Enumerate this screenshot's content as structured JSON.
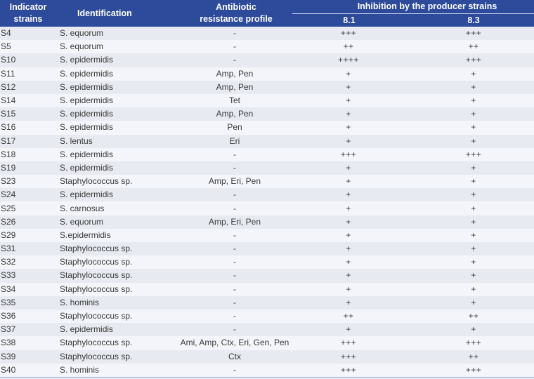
{
  "table": {
    "headers": {
      "indicator_strains": "Indicator strains",
      "identification": "Identification",
      "antibiotic_resistance_profile": "Antibiotic resistance profile",
      "inhibition_group": "Inhibition by the producer strains",
      "producer_1": "8.1",
      "producer_2": "8.3"
    },
    "rows": [
      {
        "strain": "S4",
        "identification": "S. equorum",
        "resistance": "-",
        "inh_8_1": "+++",
        "inh_8_3": "+++"
      },
      {
        "strain": "S5",
        "identification": "S. equorum",
        "resistance": "-",
        "inh_8_1": "++",
        "inh_8_3": "++"
      },
      {
        "strain": "S10",
        "identification": "S. epidermidis",
        "resistance": "-",
        "inh_8_1": "++++",
        "inh_8_3": "+++"
      },
      {
        "strain": "S11",
        "identification": "S. epidermidis",
        "resistance": "Amp, Pen",
        "inh_8_1": "+",
        "inh_8_3": "+"
      },
      {
        "strain": "S12",
        "identification": "S. epidermidis",
        "resistance": "Amp, Pen",
        "inh_8_1": "+",
        "inh_8_3": "+"
      },
      {
        "strain": "S14",
        "identification": "S. epidermidis",
        "resistance": "Tet",
        "inh_8_1": "+",
        "inh_8_3": "+"
      },
      {
        "strain": "S15",
        "identification": "S. epidermidis",
        "resistance": "Amp, Pen",
        "inh_8_1": "+",
        "inh_8_3": "+"
      },
      {
        "strain": "S16",
        "identification": "S. epidermidis",
        "resistance": "Pen",
        "inh_8_1": "+",
        "inh_8_3": "+"
      },
      {
        "strain": "S17",
        "identification": "S. lentus",
        "resistance": "Eri",
        "inh_8_1": "+",
        "inh_8_3": "+"
      },
      {
        "strain": "S18",
        "identification": "S. epidermidis",
        "resistance": "-",
        "inh_8_1": "+++",
        "inh_8_3": "+++"
      },
      {
        "strain": "S19",
        "identification": "S. epidermidis",
        "resistance": "-",
        "inh_8_1": "+",
        "inh_8_3": "+"
      },
      {
        "strain": "S23",
        "identification": "Staphylococcus sp.",
        "resistance": "Amp, Eri, Pen",
        "inh_8_1": "+",
        "inh_8_3": "+"
      },
      {
        "strain": "S24",
        "identification": "S. epidermidis",
        "resistance": "-",
        "inh_8_1": "+",
        "inh_8_3": "+"
      },
      {
        "strain": "S25",
        "identification": "S. carnosus",
        "resistance": "-",
        "inh_8_1": "+",
        "inh_8_3": "+"
      },
      {
        "strain": "S26",
        "identification": "S. equorum",
        "resistance": "Amp, Eri, Pen",
        "inh_8_1": "+",
        "inh_8_3": "+"
      },
      {
        "strain": "S29",
        "identification": "S.epidermidis",
        "resistance": "-",
        "inh_8_1": "+",
        "inh_8_3": "+"
      },
      {
        "strain": "S31",
        "identification": "Staphylococcus sp.",
        "resistance": "-",
        "inh_8_1": "+",
        "inh_8_3": "+"
      },
      {
        "strain": "S32",
        "identification": "Staphylococcus sp.",
        "resistance": "-",
        "inh_8_1": "+",
        "inh_8_3": "+"
      },
      {
        "strain": " S33",
        "identification": "Staphylococcus sp.",
        "resistance": "-",
        "inh_8_1": "+",
        "inh_8_3": "+"
      },
      {
        "strain": "S34",
        "identification": "Staphylococcus sp.",
        "resistance": "-",
        "inh_8_1": "+",
        "inh_8_3": "+"
      },
      {
        "strain": "S35",
        "identification": "S. hominis",
        "resistance": "-",
        "inh_8_1": "+",
        "inh_8_3": "+"
      },
      {
        "strain": "S36",
        "identification": "Staphylococcus sp.",
        "resistance": "-",
        "inh_8_1": "++",
        "inh_8_3": "++"
      },
      {
        "strain": "S37",
        "identification": "S. epidermidis",
        "resistance": "-",
        "inh_8_1": "+",
        "inh_8_3": "+"
      },
      {
        "strain": "S38",
        "identification": "Staphylococcus sp.",
        "resistance": "Ami, Amp, Ctx, Eri, Gen, Pen",
        "inh_8_1": "+++",
        "inh_8_3": "+++"
      },
      {
        "strain": "S39",
        "identification": "Staphylococcus sp.",
        "resistance": "Ctx",
        "inh_8_1": "+++",
        "inh_8_3": "++"
      },
      {
        "strain": "S40",
        "identification": "S. hominis",
        "resistance": "-",
        "inh_8_1": "+++",
        "inh_8_3": "+++"
      }
    ]
  },
  "colors": {
    "header_bg": "#2d4a9b",
    "header_text": "#ffffff",
    "row_odd": "#e8eaf2",
    "row_even": "#f4f5fa"
  }
}
